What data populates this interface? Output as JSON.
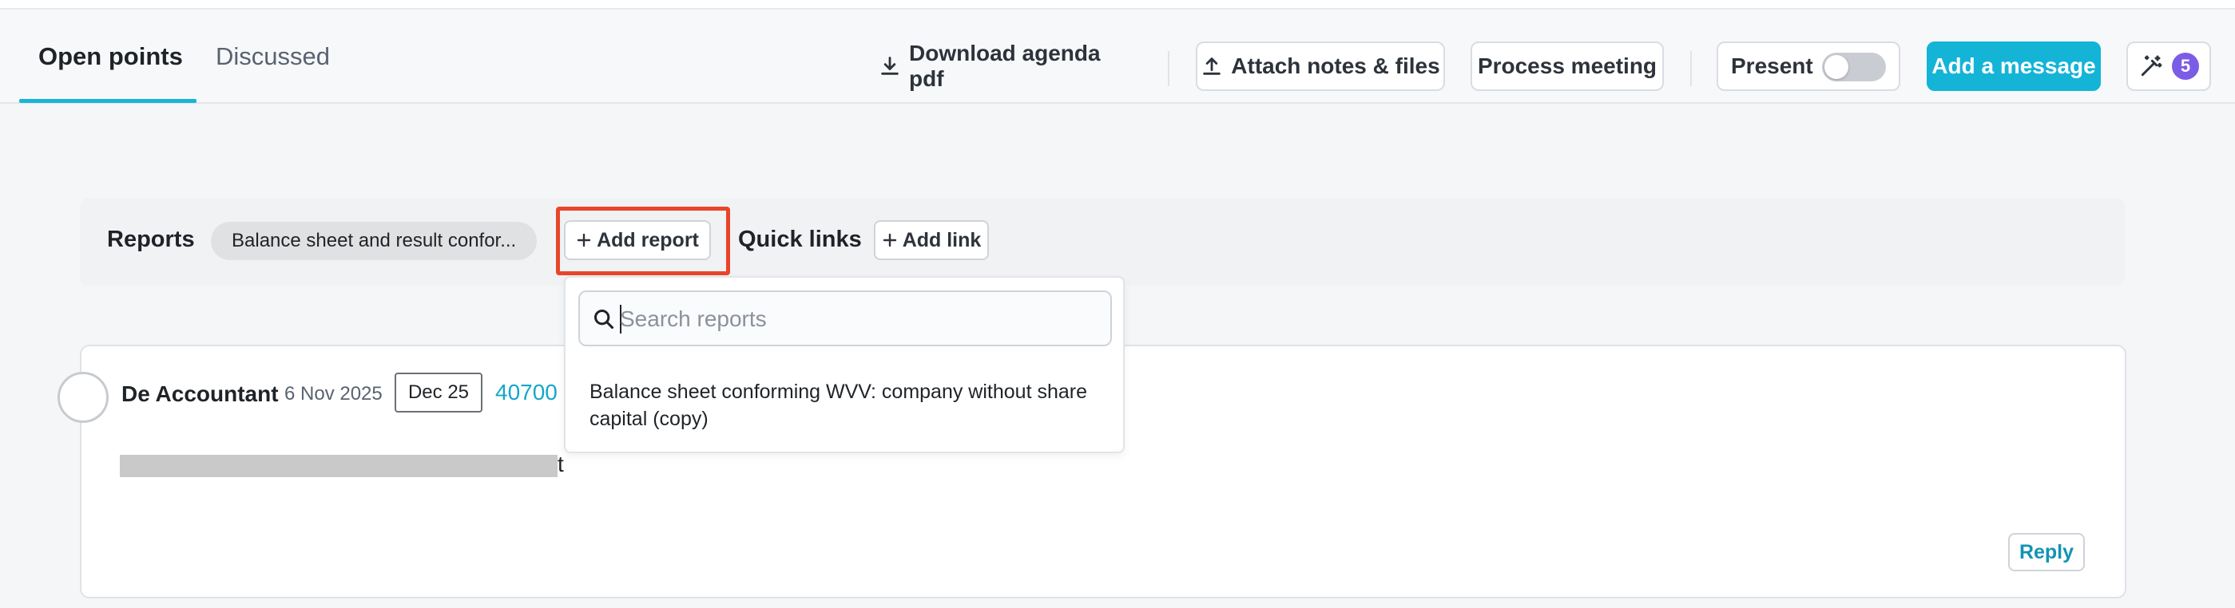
{
  "tabs": {
    "open_points": "Open points",
    "discussed": "Discussed"
  },
  "toolbar": {
    "download_agenda": "Download agenda pdf",
    "attach_notes": "Attach notes & files",
    "process_meeting": "Process meeting",
    "present": "Present",
    "present_on": false,
    "add_message": "Add a message",
    "magic_count": "5"
  },
  "reports": {
    "label": "Reports",
    "chip": "Balance sheet and result confor...",
    "add_report": "Add report"
  },
  "quick_links": {
    "label": "Quick links",
    "add_link": "Add link"
  },
  "report_search": {
    "placeholder": "Search reports",
    "results": [
      "Balance sheet conforming WVV: company without share capital (copy)"
    ]
  },
  "message": {
    "author": "De Accountant",
    "date": "6 Nov 2025",
    "period": "Dec 25",
    "code": "40700",
    "body_tail": "t",
    "reply": "Reply"
  },
  "colors": {
    "accent": "#14b4d7",
    "highlight": "#e8452a",
    "badge": "#7b5ce6"
  }
}
